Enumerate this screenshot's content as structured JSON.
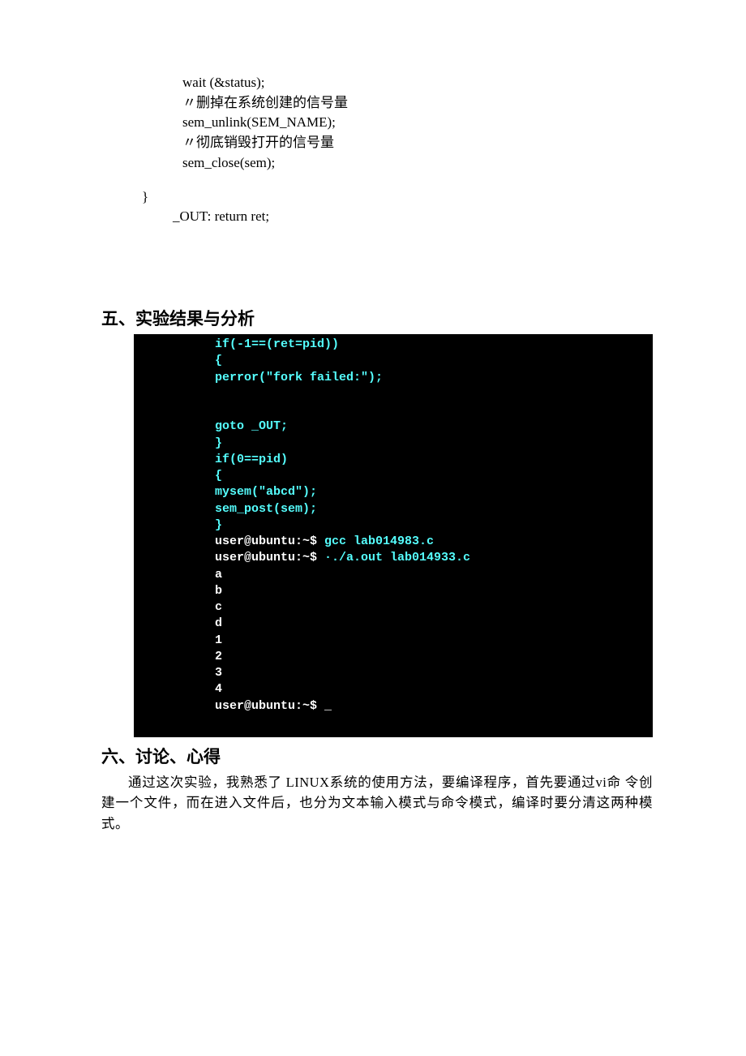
{
  "code": {
    "line1": "wait (&status);",
    "line2": "〃删掉在系统创建的信号量",
    "line3": "sem_unlink(SEM_NAME);",
    "line4": "〃彻底销毁打开的信号量",
    "line5": "sem_close(sem);"
  },
  "labelOut": "_OUT: return ret;",
  "brace": "}",
  "heading5": "五、实验结果与分析",
  "terminal": {
    "l1": "if(-1==(ret=pid))",
    "l2": "{",
    "l3": "perror(\"fork failed:\");",
    "l4": "",
    "l5": "",
    "l6": "goto _OUT;",
    "l7": "}",
    "l8": "if(0==pid)",
    "l9": "{",
    "l10": "mysem(\"abcd\");",
    "l11": "sem_post(sem);",
    "l12": "}",
    "p1a": "user@ubuntu:~$ ",
    "p1b": "gcc lab014983.c",
    "p2a": "user@ubuntu:~$ ",
    "p2b": "·./a.out lab014933.c",
    "o1": "a",
    "o2": "b",
    "o3": "c",
    "o4": "d",
    "o5": "1",
    "o6": "2",
    "o7": "3",
    "o8": "4",
    "p3": "user@ubuntu:~$ _"
  },
  "heading6": "六、讨论、心得",
  "discussion": "通过这次实验，我熟悉了 LINUX系统的使用方法，要编译程序，首先要通过vi命 令创建一个文件，而在进入文件后，也分为文本输入模式与命令模式，编译时要分清这两种模式。"
}
